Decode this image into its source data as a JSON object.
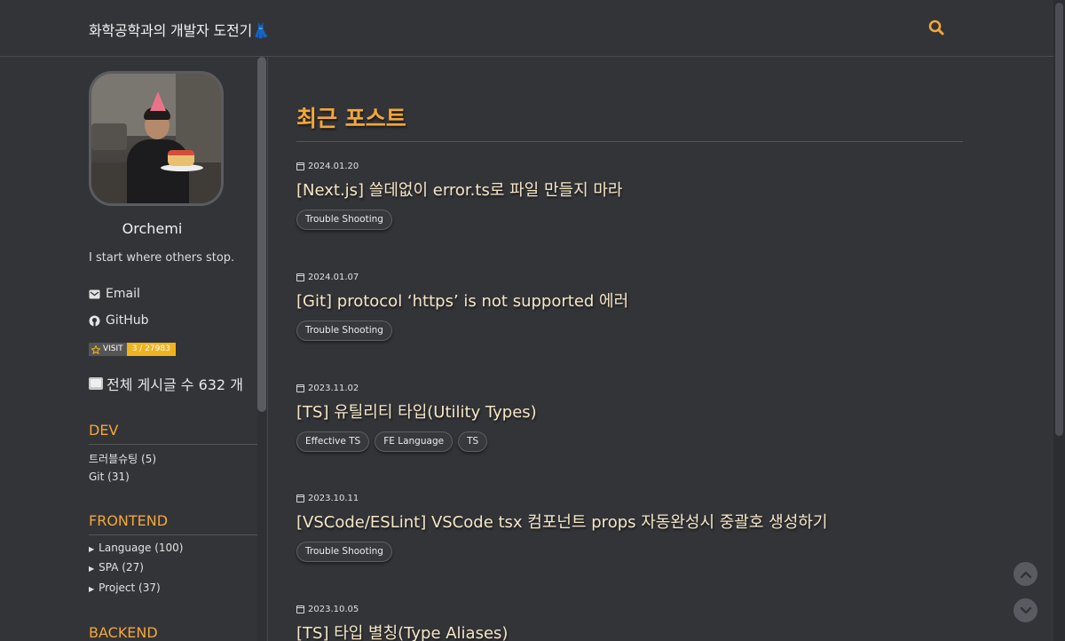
{
  "header": {
    "site_title": "화학공학과의 개발자 도전기👗",
    "search_icon": "search-icon"
  },
  "colors": {
    "background": "#333438",
    "accent": "#f3a83a",
    "post_title": "#f5e6c6",
    "visit_badge": "#f0b31f"
  },
  "sidebar": {
    "profile_name": "Orchemi",
    "bio": "I start where others stop.",
    "links": [
      {
        "label": "Email",
        "icon": "envelope-icon"
      },
      {
        "label": "GitHub",
        "icon": "github-icon"
      }
    ],
    "visit_badge": {
      "label": "VISIT",
      "count": "3 / 27983",
      "icon": "star-icon"
    },
    "total_posts": "전체 게시글 수 632 개",
    "categories": [
      {
        "title": "DEV",
        "items": [
          {
            "label": "트러블슈팅 (5)"
          },
          {
            "label": "Git (31)"
          }
        ]
      },
      {
        "title": "FRONTEND",
        "items": [
          {
            "label": "Language (100)"
          },
          {
            "label": "SPA (27)"
          },
          {
            "label": "Project (37)"
          }
        ]
      },
      {
        "title": "BACKEND",
        "items": []
      }
    ]
  },
  "main": {
    "heading": "최근 포스트",
    "posts": [
      {
        "date": "2024.01.20",
        "title": "[Next.js] 쓸데없이 error.ts로 파일 만들지 마라",
        "tags": [
          "Trouble Shooting"
        ]
      },
      {
        "date": "2024.01.07",
        "title": "[Git] protocol ‘https’ is not supported 에러",
        "tags": [
          "Trouble Shooting"
        ]
      },
      {
        "date": "2023.11.02",
        "title": "[TS] 유틸리티 타입(Utility Types)",
        "tags": [
          "Effective TS",
          "FE Language",
          "TS"
        ]
      },
      {
        "date": "2023.10.11",
        "title": "[VSCode/ESLint] VSCode tsx 컴포넌트 props 자동완성시 중괄호 생성하기",
        "tags": [
          "Trouble Shooting"
        ]
      },
      {
        "date": "2023.10.05",
        "title": "[TS] 타입 별칭(Type Aliases)",
        "tags": []
      }
    ]
  },
  "floating_buttons": {
    "up_icon": "chevron-up-icon",
    "down_icon": "chevron-down-icon"
  }
}
